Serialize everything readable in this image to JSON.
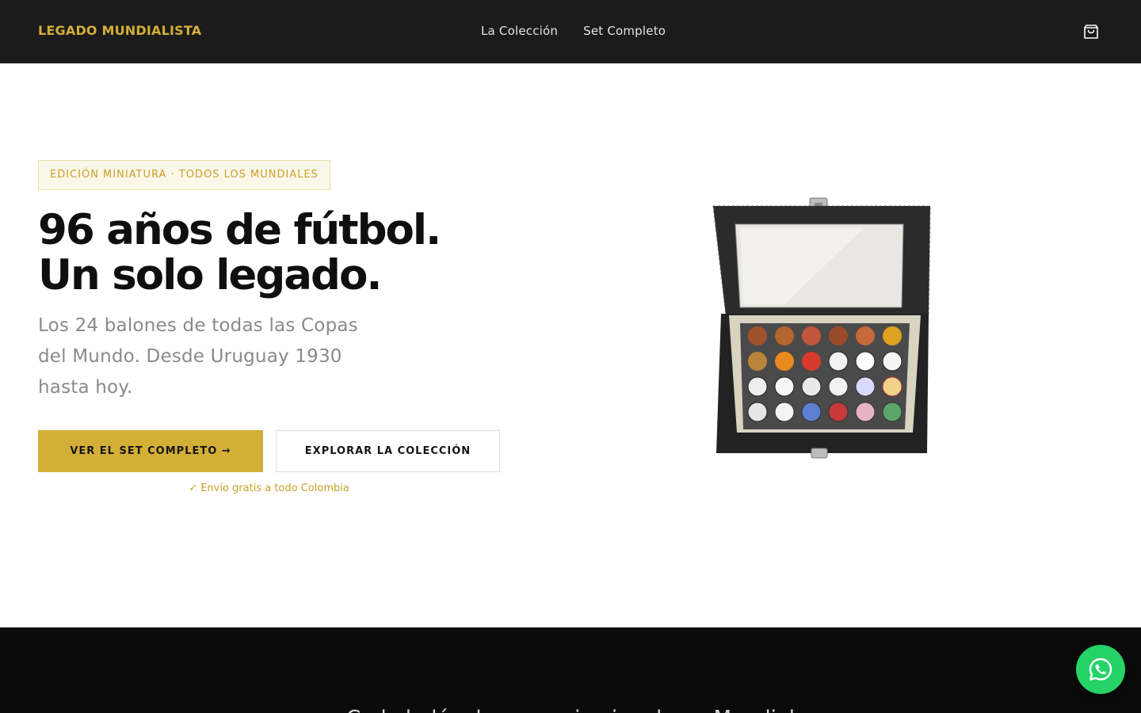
{
  "header": {
    "brand": "LEGADO MUNDIALISTA",
    "nav": [
      {
        "label": "La Colección"
      },
      {
        "label": "Set Completo"
      }
    ],
    "cart_icon": "shopping-bag-icon"
  },
  "hero": {
    "badge": "EDICIÓN MINIATURA · TODOS LOS MUNDIALES",
    "headline_line1": "96 años de fútbol.",
    "headline_line2": "Un solo legado.",
    "subtitle": "Los 24 balones de todas las Copas del Mundo. Desde Uruguay 1930 hasta hoy.",
    "primary_cta": "VER EL SET COMPLETO →",
    "secondary_cta": "EXPLORAR LA COLECCIÓN",
    "shipping_note": "✓ Envío gratis a todo Colombia",
    "product_image_icon": "display-case-image"
  },
  "band": {
    "partial_text": "Cada balón, la memoria viva de un Mundial"
  },
  "floating": {
    "whatsapp_icon": "whatsapp-icon"
  },
  "colors": {
    "accent": "#d4af37",
    "header_bg": "#1b1b1b",
    "band_bg": "#0b0b0b",
    "whatsapp": "#25d366"
  }
}
